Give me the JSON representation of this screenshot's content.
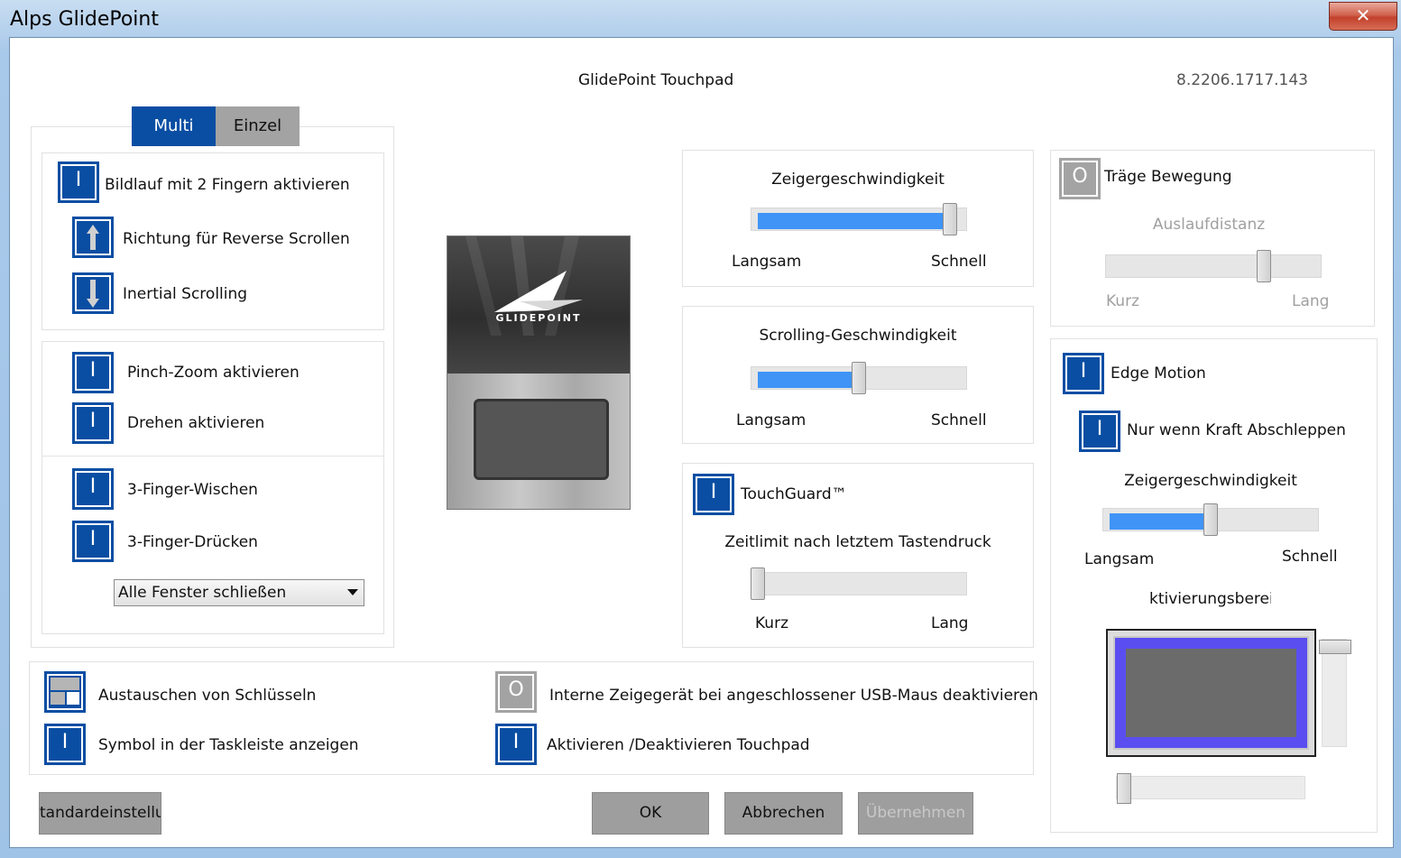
{
  "window": {
    "title": "Alps GlidePoint",
    "close_glyph": "✕"
  },
  "header": {
    "product": "GlidePoint Touchpad",
    "version": "8.2206.1717.143"
  },
  "tabs": [
    {
      "label": "Multi",
      "active": true
    },
    {
      "label": "Einzel",
      "active": false
    }
  ],
  "gestures": {
    "scroll2": "Bildlauf mit 2 Fingern aktivieren",
    "reverse": "Richtung für Reverse Scrollen",
    "inertial": "Inertial Scrolling",
    "pinch": "Pinch-Zoom aktivieren",
    "rotate": "Drehen aktivieren",
    "swipe3": "3-Finger-Wischen",
    "press3": "3-Finger-Drücken",
    "press3_action": "Alle Fenster schließen"
  },
  "logo": {
    "text": "GLIDEPOINT"
  },
  "pointer_speed": {
    "title": "Zeigergeschwindigkeit",
    "min": "Langsam",
    "max": "Schnell",
    "value": 0.95
  },
  "scroll_speed": {
    "title": "Scrolling-Geschwindigkeit",
    "min": "Langsam",
    "max": "Schnell",
    "value": 0.5
  },
  "touchguard": {
    "label": "TouchGuard™",
    "subtitle": "Zeitlimit nach letztem Tastendruck",
    "min": "Kurz",
    "max": "Lang",
    "value": 0.0
  },
  "inertia": {
    "label": "Träge Bewegung",
    "subtitle": "Auslaufdistanz",
    "min": "Kurz",
    "max": "Lang",
    "value": 0.75
  },
  "edge_motion": {
    "label": "Edge Motion",
    "force_drag": "Nur wenn Kraft Abschleppen",
    "speed_title": "Zeigergeschwindigkeit",
    "min": "Langsam",
    "max": "Schnell",
    "speed_value": 0.5,
    "area_title": "ktivierungsbereicl"
  },
  "bottom_options": {
    "swap_keys": "Austauschen von Schlüsseln",
    "tray_icon": "Symbol in der Taskleiste anzeigen",
    "disable_usb": "Interne Zeigegerät bei angeschlossener USB-Maus deaktivieren",
    "toggle_touchpad": "Aktivieren /Deaktivieren Touchpad"
  },
  "buttons": {
    "defaults": "tandardeinstellun",
    "ok": "OK",
    "cancel": "Abbrechen",
    "apply": "Übernehmen"
  },
  "glyphs": {
    "on": "I",
    "off": "O"
  },
  "colors": {
    "accent": "#0a4ea3",
    "fill": "#3f94f6",
    "off": "#a3a3a3",
    "edge_area": "#5a4ef0"
  },
  "icons": {
    "toggle": "toggle-switch-icon",
    "arrow_up": "arrow-up-icon",
    "arrow_down": "arrow-down-icon",
    "swap": "swap-keys-icon"
  }
}
